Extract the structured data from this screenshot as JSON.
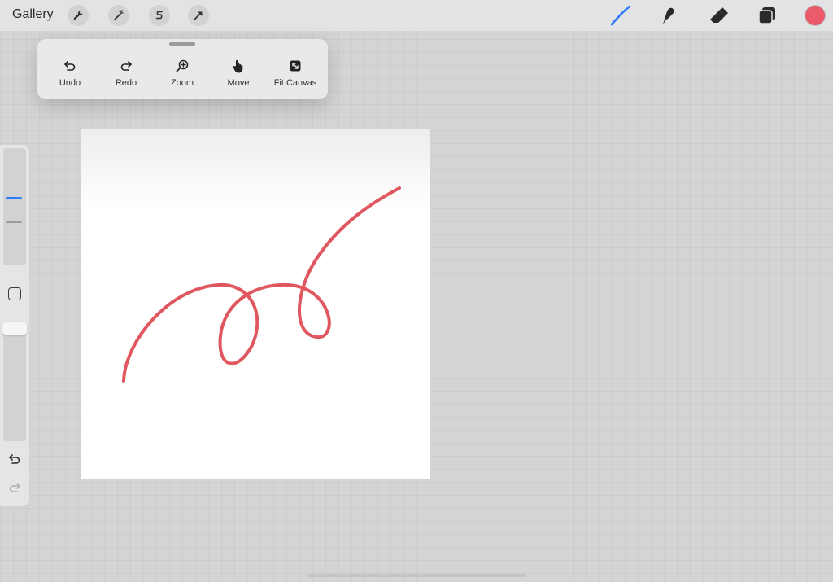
{
  "topbar": {
    "gallery_label": "Gallery",
    "actions_icon": "wrench-icon",
    "adjustments_icon": "magic-wand-icon",
    "selection_icon": "selection-s-icon",
    "transform_icon": "arrow-cursor-icon",
    "tools": [
      "brush-icon",
      "smudge-icon",
      "eraser-icon",
      "layers-icon"
    ],
    "active_tool": "brush-icon",
    "current_color": "#ea5a6a",
    "accent_color": "#2f7cf6"
  },
  "popover": {
    "items": [
      {
        "label": "Undo",
        "icon": "undo-icon"
      },
      {
        "label": "Redo",
        "icon": "redo-icon"
      },
      {
        "label": "Zoom",
        "icon": "zoom-icon"
      },
      {
        "label": "Move",
        "icon": "hand-icon"
      },
      {
        "label": "Fit Canvas",
        "icon": "fit-canvas-icon"
      }
    ]
  },
  "canvas": {
    "stroke_color": "#e0575f"
  },
  "sidebar": {
    "brush_size_icon": "size-slider",
    "modify_icon": "square-icon",
    "undo_icon": "undo-icon",
    "redo_icon": "redo-icon"
  }
}
